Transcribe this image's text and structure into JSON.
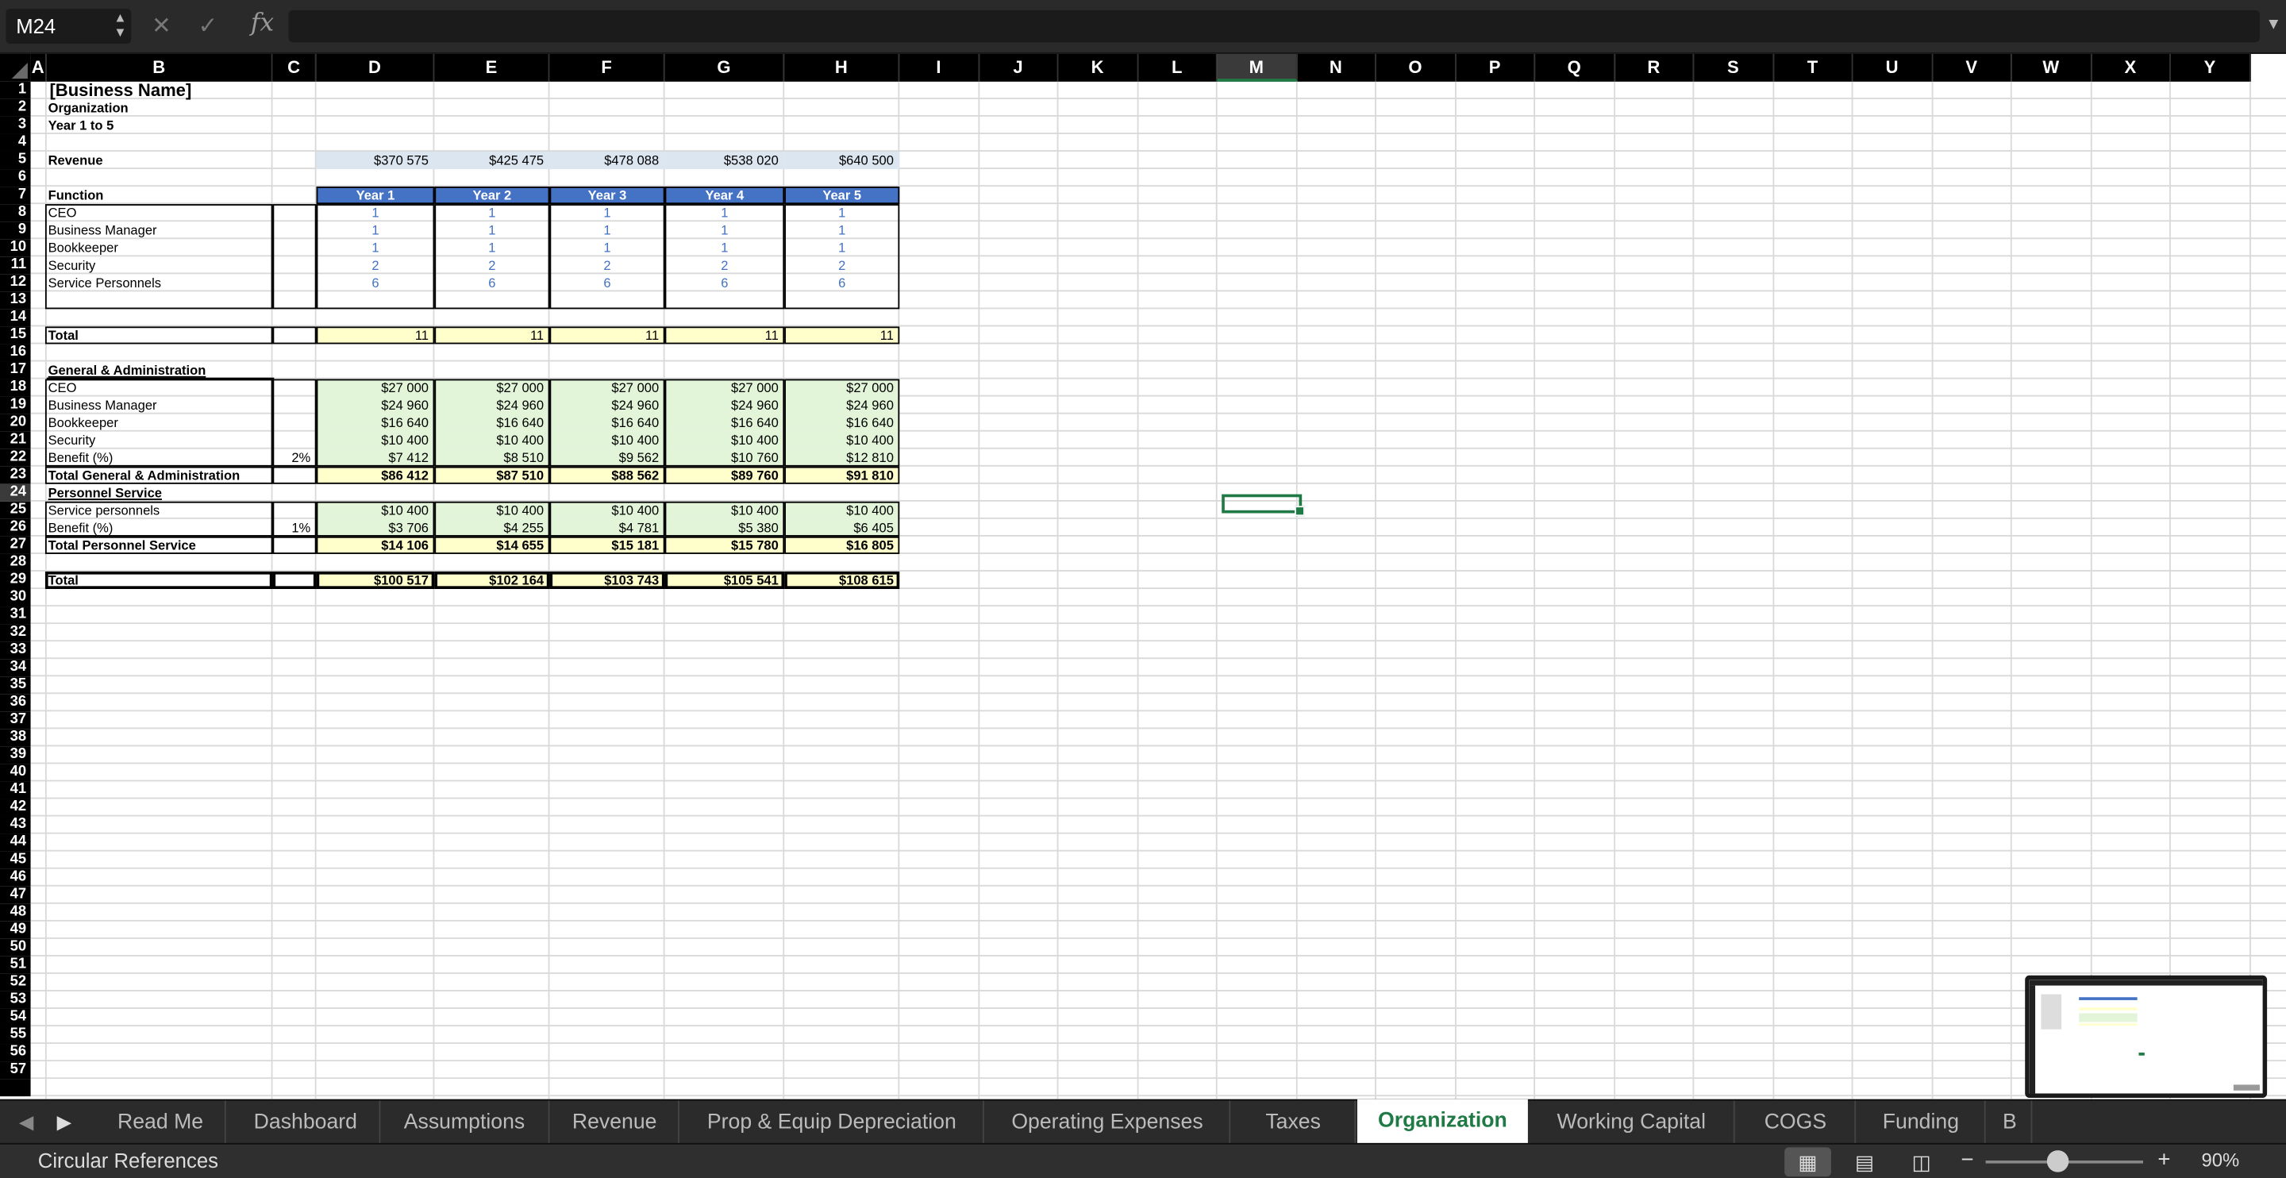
{
  "formula_bar": {
    "name_box": "M24",
    "cancel_glyph": "✕",
    "enter_glyph": "✓",
    "fx_label": "fx",
    "formula": ""
  },
  "columns": [
    "A",
    "B",
    "C",
    "D",
    "E",
    "F",
    "G",
    "H",
    "I",
    "J",
    "K",
    "L",
    "M",
    "N",
    "O",
    "P",
    "Q",
    "R",
    "S",
    "T",
    "U",
    "V",
    "W",
    "X",
    "Y"
  ],
  "selected_column": "M",
  "selected_row": 24,
  "row_count": 57,
  "sheet": {
    "title": "[Business Name]",
    "subtitle": "Organization",
    "period": "Year 1 to 5",
    "revenue_label": "Revenue",
    "revenue": [
      "$370 575",
      "$425 475",
      "$478 088",
      "$538 020",
      "$640 500"
    ],
    "function_label": "Function",
    "years": [
      "Year 1",
      "Year 2",
      "Year 3",
      "Year 4",
      "Year 5"
    ],
    "headcount": [
      {
        "role": "CEO",
        "values": [
          "1",
          "1",
          "1",
          "1",
          "1"
        ]
      },
      {
        "role": "Business Manager",
        "values": [
          "1",
          "1",
          "1",
          "1",
          "1"
        ]
      },
      {
        "role": "Bookkeeper",
        "values": [
          "1",
          "1",
          "1",
          "1",
          "1"
        ]
      },
      {
        "role": "Security",
        "values": [
          "2",
          "2",
          "2",
          "2",
          "2"
        ]
      },
      {
        "role": "Service Personnels",
        "values": [
          "6",
          "6",
          "6",
          "6",
          "6"
        ]
      }
    ],
    "total_label": "Total",
    "total_headcount": [
      "11",
      "11",
      "11",
      "11",
      "11"
    ],
    "ga_label": "General & Administration",
    "ga_rows": [
      {
        "role": "CEO",
        "pct": "",
        "values": [
          "$27 000",
          "$27 000",
          "$27 000",
          "$27 000",
          "$27 000"
        ]
      },
      {
        "role": "Business Manager",
        "pct": "",
        "values": [
          "$24 960",
          "$24 960",
          "$24 960",
          "$24 960",
          "$24 960"
        ]
      },
      {
        "role": "Bookkeeper",
        "pct": "",
        "values": [
          "$16 640",
          "$16 640",
          "$16 640",
          "$16 640",
          "$16 640"
        ]
      },
      {
        "role": "Security",
        "pct": "",
        "values": [
          "$10 400",
          "$10 400",
          "$10 400",
          "$10 400",
          "$10 400"
        ]
      },
      {
        "role": "Benefit (%)",
        "pct": "2%",
        "values": [
          "$7 412",
          "$8 510",
          "$9 562",
          "$10 760",
          "$12 810"
        ]
      }
    ],
    "ga_total_label": "Total General & Administration",
    "ga_total": [
      "$86 412",
      "$87 510",
      "$88 562",
      "$89 760",
      "$91 810"
    ],
    "ps_label": "Personnel Service",
    "ps_rows": [
      {
        "role": "Service personnels",
        "pct": "",
        "values": [
          "$10 400",
          "$10 400",
          "$10 400",
          "$10 400",
          "$10 400"
        ]
      },
      {
        "role": "Benefit (%)",
        "pct": "1%",
        "values": [
          "$3 706",
          "$4 255",
          "$4 781",
          "$5 380",
          "$6 405"
        ]
      }
    ],
    "ps_total_label": "Total Personnel Service",
    "ps_total": [
      "$14 106",
      "$14 655",
      "$15 181",
      "$15 780",
      "$16 805"
    ],
    "grand_total_label": "Total",
    "grand_total": [
      "$100 517",
      "$102 164",
      "$103 743",
      "$105 541",
      "$108 615"
    ]
  },
  "tabs": [
    {
      "label": "Read Me"
    },
    {
      "label": "Dashboard"
    },
    {
      "label": "Assumptions"
    },
    {
      "label": "Revenue"
    },
    {
      "label": "Prop & Equip Depreciation"
    },
    {
      "label": "Operating Expenses"
    },
    {
      "label": "Taxes"
    },
    {
      "label": "Organization"
    },
    {
      "label": "Working Capital"
    },
    {
      "label": "COGS"
    },
    {
      "label": "Funding"
    },
    {
      "label": "B"
    }
  ],
  "active_tab": "Organization",
  "status": {
    "left_text": "Circular References",
    "zoom_minus": "−",
    "zoom_plus": "+",
    "zoom": "90%"
  },
  "colors": {
    "accent": "#1f7a45",
    "header_blue": "#4472c4",
    "revenue_fill": "#dce6f1",
    "total_fill": "#ffffcc",
    "salary_fill": "#e2f5d8"
  }
}
